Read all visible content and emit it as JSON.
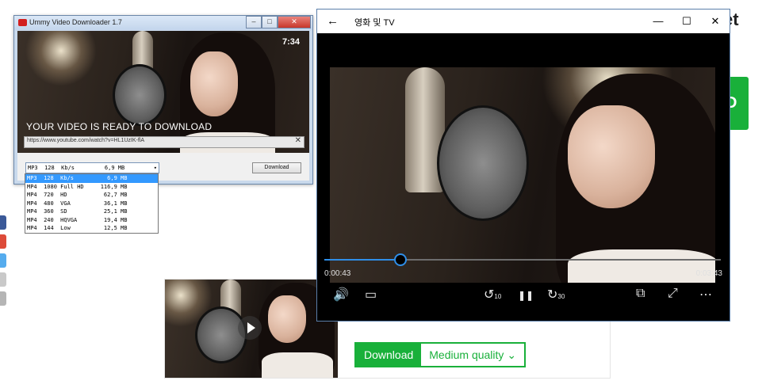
{
  "background_page": {
    "title_fragment": "et",
    "green_button_fragment": "D",
    "download_button": "Download",
    "quality_select": "Medium quality",
    "colors": {
      "green": "#19b03a"
    }
  },
  "ummy": {
    "title": "Ummy Video Downloader 1.7",
    "controls": [
      "–",
      "□",
      "✕"
    ],
    "duration": "7:34",
    "ready_text": "YOUR VIDEO IS READY TO DOWNLOAD",
    "url": "https://www.youtube.com/watch?v=HL1UzIK-flA",
    "clear_icon": "✕",
    "selected_format": "MP3  128  Kb/s         6,9 MB",
    "download_label": "Download",
    "formats": [
      "MP3  128  Kb/s          6,9 MB",
      "MP4  1080 Full HD     116,9 MB",
      "MP4  720  HD           62,7 MB",
      "MP4  480  VGA          36,1 MB",
      "MP4  360  SD           25,1 MB",
      "MP4  240  HQVGA        19,4 MB",
      "MP4  144  Low          12,5 MB"
    ],
    "selected_index": 0
  },
  "movies_tv": {
    "back": "←",
    "title": "영화 및 TV",
    "controls": [
      "—",
      "☐",
      "✕"
    ],
    "current_time": "0:00:43",
    "total_time": "0:03:43",
    "progress": 0.19,
    "skip_back_label": "10",
    "skip_forward_label": "30",
    "icons": {
      "volume": "🔊",
      "captions": "▭",
      "skip_back": "↺",
      "pause": "❚❚",
      "skip_forward": "↻",
      "mini_view": "⧉",
      "fullscreen": "⤢",
      "more": "⋯"
    },
    "colors": {
      "accent": "#2f8ee8"
    }
  }
}
